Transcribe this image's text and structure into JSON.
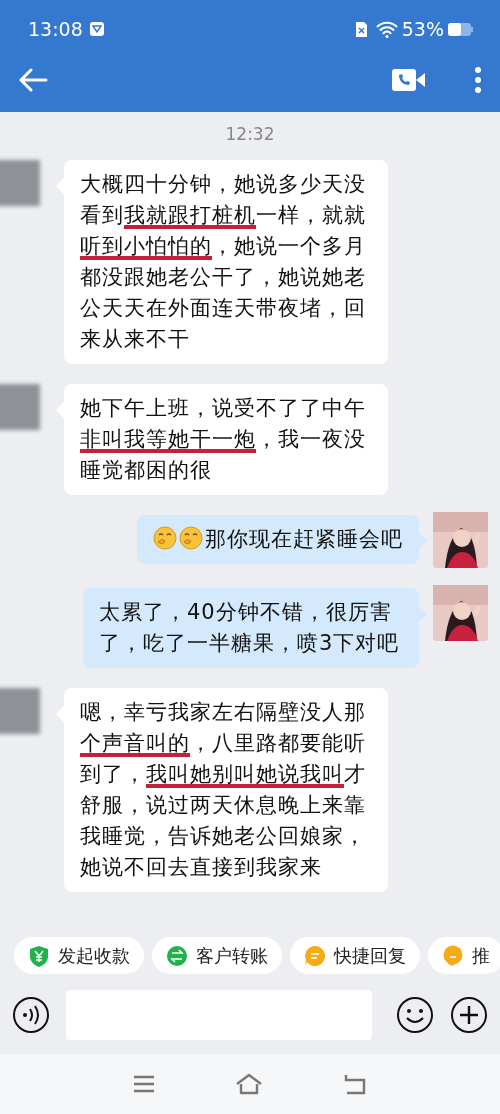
{
  "status_bar": {
    "time": "13:08",
    "battery": "53%"
  },
  "chat": {
    "timestamp": "12:32",
    "messages": [
      {
        "kind": "incoming",
        "segments": [
          {
            "kind": "text",
            "text": "大概四十分钟，她说多少天没看到",
            "struck": false
          },
          {
            "kind": "text",
            "text": "我就跟打桩机",
            "struck": true
          },
          {
            "kind": "text",
            "text": "一样，就就",
            "struck": false
          },
          {
            "kind": "text",
            "text": "听到小怕怕的",
            "struck": true
          },
          {
            "kind": "text",
            "text": "，她说一个多月都没跟她老公干了，她说她老公天天在外面连天带夜堵，回来从来不干",
            "struck": false
          }
        ]
      },
      {
        "kind": "incoming",
        "segments": [
          {
            "kind": "text",
            "text": "她下午上班，说受不了了中午",
            "struck": false
          },
          {
            "kind": "text",
            "text": "非叫我等她干一炮",
            "struck": true
          },
          {
            "kind": "text",
            "text": "，我一夜没睡觉都困的很",
            "struck": false
          }
        ]
      },
      {
        "kind": "outgoing",
        "segments": [
          {
            "kind": "emoji"
          },
          {
            "kind": "emoji"
          },
          {
            "kind": "text",
            "text": "那你现在赶紧睡会吧",
            "struck": false
          }
        ]
      },
      {
        "kind": "outgoing",
        "segments": [
          {
            "kind": "text",
            "text": "太累了，40分钟不错，很厉害了，吃了一半糖果，喷3下对吧",
            "struck": false
          }
        ]
      },
      {
        "kind": "incoming",
        "segments": [
          {
            "kind": "text",
            "text": "嗯，幸亏我家左右隔壁没人那",
            "struck": false
          },
          {
            "kind": "text",
            "text": "个声音叫的",
            "struck": true
          },
          {
            "kind": "text",
            "text": "，八里路都要能听到了，",
            "struck": false
          },
          {
            "kind": "text",
            "text": "我叫她别叫她说我叫",
            "struck": true
          },
          {
            "kind": "text",
            "text": "才舒服，说过两天休息晚上来靠我睡觉，告诉她老公回娘家，她说不回去直接到我家来",
            "struck": false
          }
        ]
      }
    ]
  },
  "quick_actions": [
    {
      "kind": "payment",
      "label": "发起收款"
    },
    {
      "kind": "transfer",
      "label": "客户转账"
    },
    {
      "kind": "reply",
      "label": "快捷回复"
    },
    {
      "kind": "recommend",
      "label": "推"
    }
  ]
}
